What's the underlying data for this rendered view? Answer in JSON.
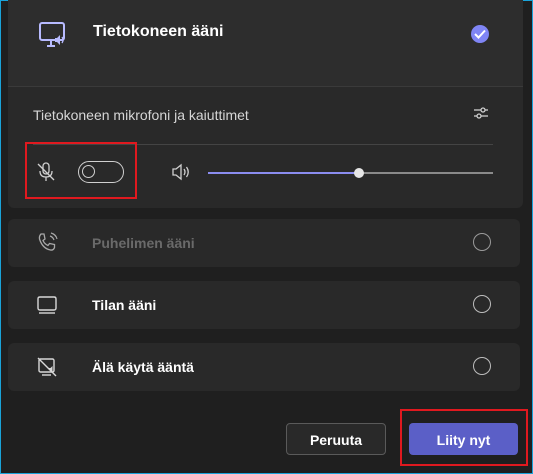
{
  "audio_options": {
    "computer_audio": {
      "label": "Tietokoneen ääni",
      "selected": true,
      "icon": "monitor-speaker-icon",
      "devices_label": "Tietokoneen mikrofoni ja kaiuttimet",
      "mic_enabled": false,
      "speaker_volume": 0.53
    },
    "phone_audio": {
      "label": "Puhelimen ääni",
      "disabled": true,
      "icon": "phone-icon"
    },
    "room_audio": {
      "label": "Tilan ääni",
      "icon": "room-device-icon"
    },
    "no_audio": {
      "label": "Älä käytä ääntä",
      "icon": "no-audio-icon"
    }
  },
  "buttons": {
    "cancel": "Peruuta",
    "join": "Liity nyt"
  },
  "colors": {
    "accent": "#5b5fc7",
    "check": "#7f85f5",
    "highlight": "#e0191f",
    "background": "#1f1f1f",
    "card": "#292929"
  }
}
